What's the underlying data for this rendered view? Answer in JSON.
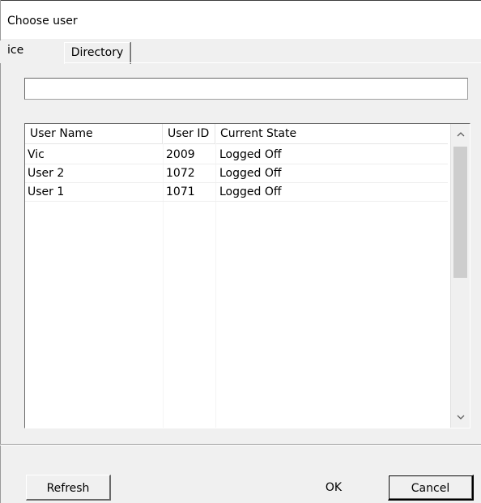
{
  "window": {
    "title": "Choose user"
  },
  "tabs": [
    {
      "label": "ice",
      "active": true
    },
    {
      "label": "Directory",
      "active": false
    }
  ],
  "search": {
    "value": "",
    "placeholder": ""
  },
  "table": {
    "columns": [
      "User Name",
      "User ID",
      "Current State"
    ],
    "rows": [
      {
        "user_name": "Vic",
        "user_id": "2009",
        "current_state": "Logged Off"
      },
      {
        "user_name": "User 2",
        "user_id": "1072",
        "current_state": "Logged Off"
      },
      {
        "user_name": "User 1",
        "user_id": "1071",
        "current_state": "Logged Off"
      }
    ]
  },
  "scrollbar": {
    "up_icon": "chevron-up-icon",
    "down_icon": "chevron-down-icon"
  },
  "buttons": {
    "refresh": "Refresh",
    "ok": "OK",
    "cancel": "Cancel"
  }
}
